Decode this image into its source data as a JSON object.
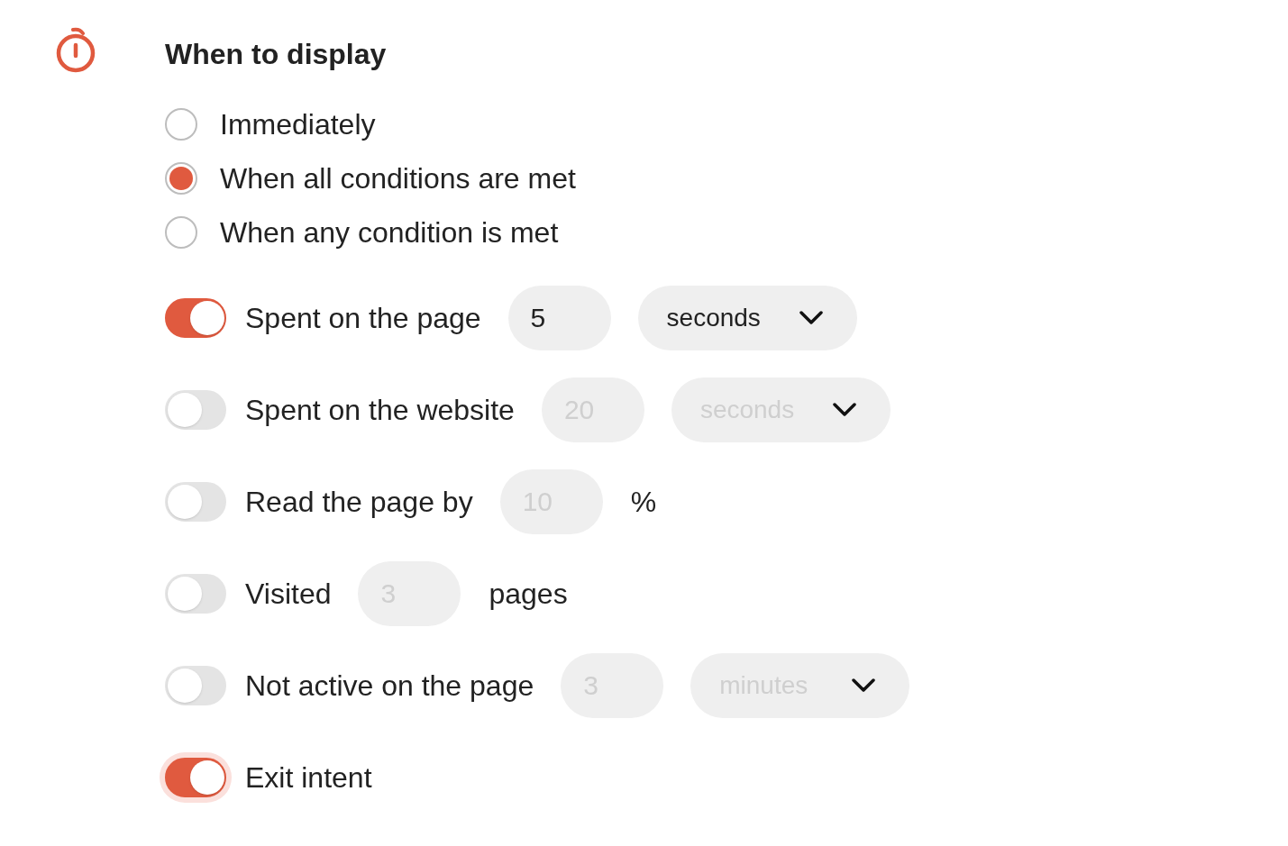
{
  "section": {
    "title": "When to display"
  },
  "display_modes": [
    {
      "label": "Immediately",
      "selected": false
    },
    {
      "label": "When all conditions are met",
      "selected": true
    },
    {
      "label": "When any condition is met",
      "selected": false
    }
  ],
  "conditions": [
    {
      "label": "Spent on the page",
      "on": true,
      "focused": false,
      "kind": "select",
      "value": "5",
      "unit": "seconds"
    },
    {
      "label": "Spent on the website",
      "on": false,
      "focused": false,
      "kind": "select",
      "value": "20",
      "unit": "seconds"
    },
    {
      "label": "Read the page by",
      "on": false,
      "focused": false,
      "kind": "suffix",
      "value": "10",
      "suffix": "%"
    },
    {
      "label": "Visited",
      "on": false,
      "focused": false,
      "kind": "suffix",
      "value": "3",
      "suffix": "pages"
    },
    {
      "label": "Not active on the page",
      "on": false,
      "focused": false,
      "kind": "select",
      "value": "3",
      "unit": "minutes"
    },
    {
      "label": "Exit intent",
      "on": true,
      "focused": true,
      "kind": "plain"
    }
  ]
}
